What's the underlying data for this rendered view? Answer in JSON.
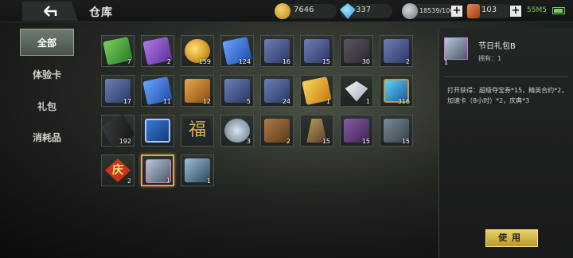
{
  "header": {
    "title": "仓库",
    "back_icon": "back-arrow-icon"
  },
  "currencies": [
    {
      "name": "gold-coin-icon",
      "value": "7646"
    },
    {
      "name": "diamond-icon",
      "value": "337"
    },
    {
      "name": "stamina-icon",
      "value": "18539/100"
    },
    {
      "name": "ticket-icon",
      "value": "103"
    }
  ],
  "status": {
    "clock": "55M5"
  },
  "sidebar": {
    "items": [
      {
        "label": "全部",
        "active": true
      },
      {
        "label": "体验卡",
        "active": false
      },
      {
        "label": "礼包",
        "active": false
      },
      {
        "label": "消耗品",
        "active": false
      }
    ]
  },
  "inventory": {
    "items": [
      {
        "icon": "green-ticket-icon",
        "qty": "7",
        "art": "a-green",
        "glyph": ""
      },
      {
        "icon": "purple-ticket-icon",
        "qty": "2",
        "art": "a-purple",
        "glyph": ""
      },
      {
        "icon": "gold-coin-icon",
        "qty": "159",
        "art": "a-gold",
        "glyph": ""
      },
      {
        "icon": "blue-ticket-icon",
        "qty": "124",
        "art": "a-blue",
        "glyph": ""
      },
      {
        "icon": "card-icon",
        "qty": "16",
        "art": "a-card",
        "glyph": ""
      },
      {
        "icon": "card-icon",
        "qty": "15",
        "art": "a-card",
        "glyph": ""
      },
      {
        "icon": "book-icon",
        "qty": "30",
        "art": "a-book",
        "glyph": ""
      },
      {
        "icon": "contract-card-icon",
        "qty": "2",
        "art": "a-card",
        "glyph": ""
      },
      {
        "icon": "card-icon",
        "qty": "17",
        "art": "a-card",
        "glyph": ""
      },
      {
        "icon": "blue-ticket-icon",
        "qty": "11",
        "art": "a-blue",
        "glyph": ""
      },
      {
        "icon": "contract-coin-icon",
        "qty": "12",
        "art": "a-orange",
        "glyph": ""
      },
      {
        "icon": "card-icon",
        "qty": "5",
        "art": "a-card",
        "glyph": ""
      },
      {
        "icon": "tutorial-card-icon",
        "qty": "24",
        "art": "a-card",
        "glyph": ""
      },
      {
        "icon": "yellow-ticket-icon",
        "qty": "1",
        "art": "a-yellow",
        "glyph": ""
      },
      {
        "icon": "diamond-icon",
        "qty": "1",
        "art": "a-diamond",
        "glyph": ""
      },
      {
        "icon": "phone-card-icon",
        "qty": "316",
        "art": "a-phone",
        "glyph": ""
      },
      {
        "icon": "radio-icon",
        "qty": "192",
        "art": "a-radio",
        "glyph": ""
      },
      {
        "icon": "rename-plate-icon",
        "qty": "",
        "art": "a-plate",
        "glyph": ""
      },
      {
        "icon": "fu-icon",
        "qty": "",
        "art": "a-fu",
        "glyph": "福"
      },
      {
        "icon": "medal-icon",
        "qty": "3",
        "art": "a-medal",
        "glyph": ""
      },
      {
        "icon": "brown-book-icon",
        "qty": "2",
        "art": "a-brown",
        "glyph": ""
      },
      {
        "icon": "brush-icon",
        "qty": "15",
        "art": "a-brush",
        "glyph": ""
      },
      {
        "icon": "treasure-box-icon",
        "qty": "15",
        "art": "a-box",
        "glyph": ""
      },
      {
        "icon": "steel-book-icon",
        "qty": "15",
        "art": "a-steel",
        "glyph": ""
      },
      {
        "icon": "celebration-icon",
        "qty": "2",
        "art": "a-red",
        "glyph": "庆"
      },
      {
        "icon": "gift-box-icon",
        "qty": "1",
        "art": "a-gift",
        "glyph": "",
        "selected": true
      },
      {
        "icon": "gift-box-blue-icon",
        "qty": "1",
        "art": "a-gift2",
        "glyph": ""
      }
    ]
  },
  "detail": {
    "icon": "gift-box-icon",
    "qty": "1",
    "name": "节日礼包B",
    "owned": "拥有：1",
    "description": "打开获得：超级夺宝券*15，精英合约*2，加速卡（8小时）*2，庆典*3",
    "use_label": "使用"
  }
}
